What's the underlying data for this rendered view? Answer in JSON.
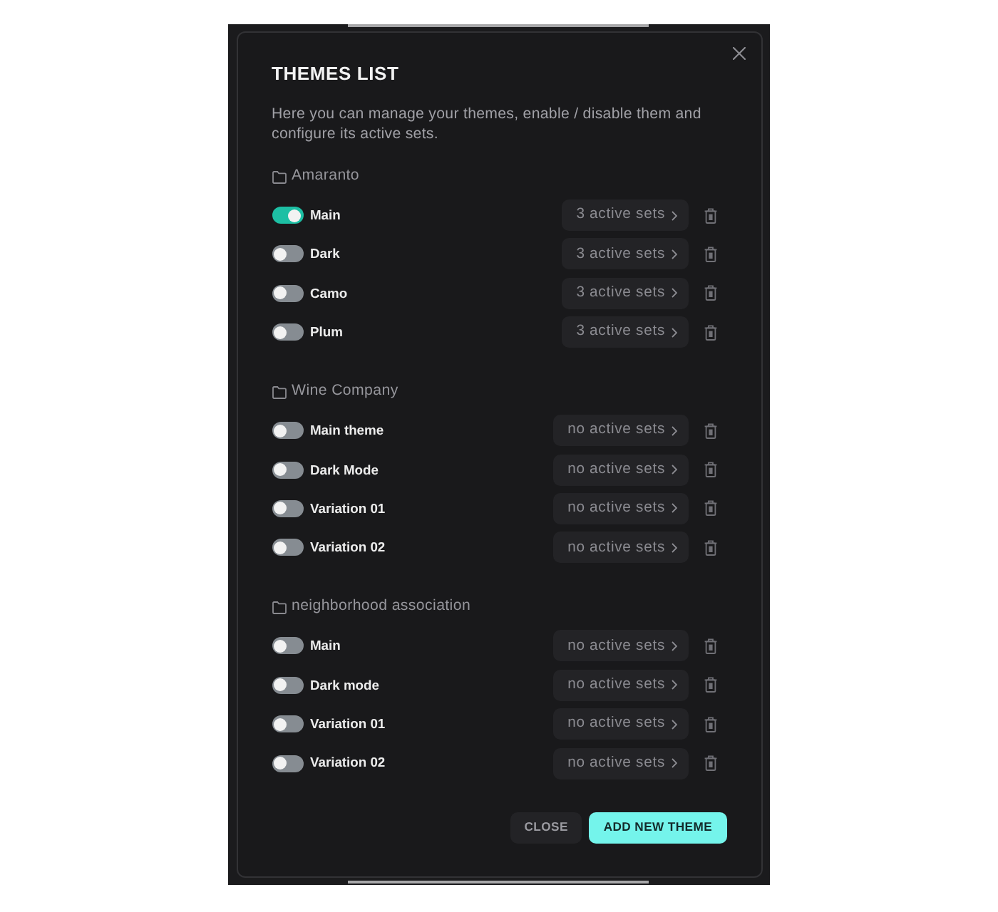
{
  "dialog": {
    "title": "THEMES LIST",
    "description": "Here you can manage your themes, enable / disable them and configure its active sets.",
    "groups": [
      {
        "name": "Amaranto",
        "themes": [
          {
            "name": "Main",
            "on": true,
            "sets": "3 active sets"
          },
          {
            "name": "Dark",
            "on": false,
            "sets": "3 active sets"
          },
          {
            "name": "Camo",
            "on": false,
            "sets": "3 active sets"
          },
          {
            "name": "Plum",
            "on": false,
            "sets": "3 active sets"
          }
        ]
      },
      {
        "name": "Wine Company",
        "themes": [
          {
            "name": "Main theme",
            "on": false,
            "sets": "no active sets"
          },
          {
            "name": "Dark Mode",
            "on": false,
            "sets": "no active sets"
          },
          {
            "name": "Variation 01",
            "on": false,
            "sets": "no active sets"
          },
          {
            "name": "Variation 02",
            "on": false,
            "sets": "no active sets"
          }
        ]
      },
      {
        "name": "neighborhood association",
        "themes": [
          {
            "name": "Main",
            "on": false,
            "sets": "no active sets"
          },
          {
            "name": "Dark mode",
            "on": false,
            "sets": "no active sets"
          },
          {
            "name": "Variation 01",
            "on": false,
            "sets": "no active sets"
          },
          {
            "name": "Variation 02",
            "on": false,
            "sets": "no active sets"
          }
        ]
      }
    ],
    "buttons": [
      {
        "label": "CLOSE",
        "kind": "secondary"
      },
      {
        "label": "ADD NEW THEME",
        "kind": "primary"
      }
    ]
  }
}
